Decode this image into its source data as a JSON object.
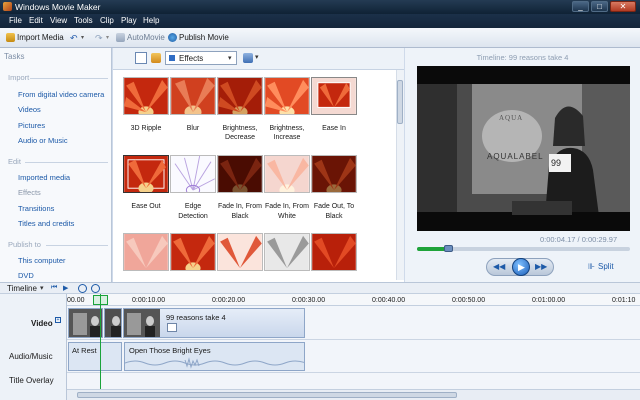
{
  "window": {
    "title": "Windows Movie Maker",
    "min": "_",
    "max": "□",
    "close": "✕"
  },
  "menu": [
    "File",
    "Edit",
    "View",
    "Tools",
    "Clip",
    "Play",
    "Help"
  ],
  "toolbar": {
    "import_media": "Import Media",
    "automovie": "AutoMovie",
    "publish_movie": "Publish Movie"
  },
  "tasks": {
    "header": "Tasks",
    "sections": [
      {
        "title": "Import",
        "items": [
          "From digital video camera",
          "Videos",
          "Pictures",
          "Audio or Music"
        ]
      },
      {
        "title": "Edit",
        "items": [
          "Imported media",
          "Effects",
          "Transitions",
          "Titles and credits"
        ]
      },
      {
        "title": "Publish to",
        "items": [
          "This computer",
          "DVD"
        ]
      }
    ]
  },
  "effects_pane": {
    "dropdown_value": "Effects",
    "items": [
      {
        "label1": "3D Ripple",
        "label2": ""
      },
      {
        "label1": "Blur",
        "label2": ""
      },
      {
        "label1": "Brightness,",
        "label2": "Decrease"
      },
      {
        "label1": "Brightness,",
        "label2": "Increase"
      },
      {
        "label1": "Ease In",
        "label2": ""
      },
      {
        "label1": "Ease Out",
        "label2": ""
      },
      {
        "label1": "Edge",
        "label2": "Detection"
      },
      {
        "label1": "Fade In, From",
        "label2": "Black"
      },
      {
        "label1": "Fade In, From",
        "label2": "White"
      },
      {
        "label1": "Fade Out, To",
        "label2": "Black"
      }
    ]
  },
  "preview": {
    "title": "Timeline: 99 reasons take 4",
    "video_text": {
      "logo_line1": "AQUA",
      "logo_line2": "AQUALABEL",
      "card": "99"
    },
    "time": "0:00:04.17 / 0:00:29.97",
    "split": "Split"
  },
  "timeline": {
    "label": "Timeline",
    "ticks": [
      "00.00",
      "0:00:10.00",
      "0:00:20.00",
      "0:00:30.00",
      "0:00:40.00",
      "0:00:50.00",
      "0:01:00.00",
      "0:01:10"
    ],
    "tracks": {
      "video": "Video",
      "audio": "Audio/Music",
      "overlay": "Title Overlay"
    },
    "video_clip_title": "99 reasons take 4",
    "audio_clips": [
      "At Rest",
      "Open Those Bright Eyes"
    ]
  },
  "colors": {
    "accent": "#1d5aa8",
    "playhead": "#1aa33a",
    "titlebar": "#13253a"
  }
}
